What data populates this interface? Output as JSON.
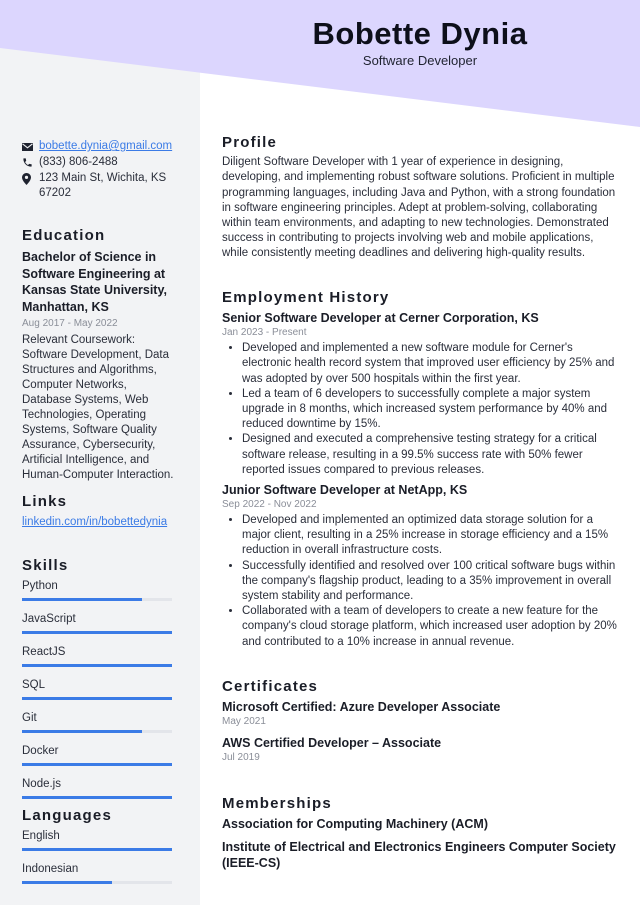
{
  "header": {
    "name": "Bobette Dynia",
    "title": "Software Developer"
  },
  "colors": {
    "header_bg": "#dcd6fe",
    "sidebar_bg": "#f2f3f5",
    "accent": "#3b7be6"
  },
  "contact": {
    "email": "bobette.dynia@gmail.com",
    "phone": "(833) 806-2488",
    "address": "123 Main St, Wichita, KS 67202",
    "icons": [
      "envelope-icon",
      "phone-icon",
      "map-pin-icon"
    ]
  },
  "education": {
    "heading": "Education",
    "degree": "Bachelor of Science in Software Engineering at Kansas State University, Manhattan, KS",
    "dates": "Aug 2017 - May 2022",
    "description": "Relevant Coursework: Software Development, Data Structures and Algorithms, Computer Networks, Database Systems, Web Technologies, Operating Systems, Software Quality Assurance, Cybersecurity, Artificial Intelligence, and Human-Computer Interaction."
  },
  "links": {
    "heading": "Links",
    "items": [
      {
        "label": "linkedin.com/in/bobettedynia"
      }
    ]
  },
  "skills": {
    "heading": "Skills",
    "items": [
      {
        "name": "Python",
        "level": 0.8
      },
      {
        "name": "JavaScript",
        "level": 1.0
      },
      {
        "name": "ReactJS",
        "level": 1.0
      },
      {
        "name": "SQL",
        "level": 1.0
      },
      {
        "name": "Git",
        "level": 0.8
      },
      {
        "name": "Docker",
        "level": 1.0
      },
      {
        "name": "Node.js",
        "level": 1.0
      }
    ]
  },
  "languages": {
    "heading": "Languages",
    "items": [
      {
        "name": "English",
        "level": 1.0
      },
      {
        "name": "Indonesian",
        "level": 0.6
      }
    ]
  },
  "profile": {
    "heading": "Profile",
    "text": "Diligent Software Developer with 1 year of experience in designing, developing, and implementing robust software solutions. Proficient in multiple programming languages, including Java and Python, with a strong foundation in software engineering principles. Adept at problem-solving, collaborating within team environments, and adapting to new technologies. Demonstrated success in contributing to projects involving web and mobile applications, while consistently meeting deadlines and delivering high-quality results."
  },
  "employment": {
    "heading": "Employment History",
    "jobs": [
      {
        "title": "Senior Software Developer at Cerner Corporation, KS",
        "dates": "Jan 2023 - Present",
        "bullets": [
          "Developed and implemented a new software module for Cerner's electronic health record system that improved user efficiency by 25% and was adopted by over 500 hospitals within the first year.",
          "Led a team of 6 developers to successfully complete a major system upgrade in 8 months, which increased system performance by 40% and reduced downtime by 15%.",
          "Designed and executed a comprehensive testing strategy for a critical software release, resulting in a 99.5% success rate with 50% fewer reported issues compared to previous releases."
        ]
      },
      {
        "title": "Junior Software Developer at NetApp, KS",
        "dates": "Sep 2022 - Nov 2022",
        "bullets": [
          "Developed and implemented an optimized data storage solution for a major client, resulting in a 25% increase in storage efficiency and a 15% reduction in overall infrastructure costs.",
          "Successfully identified and resolved over 100 critical software bugs within the company's flagship product, leading to a 35% improvement in overall system stability and performance.",
          "Collaborated with a team of developers to create a new feature for the company's cloud storage platform, which increased user adoption by 20% and contributed to a 10% increase in annual revenue."
        ]
      }
    ]
  },
  "certificates": {
    "heading": "Certificates",
    "items": [
      {
        "name": "Microsoft Certified: Azure Developer Associate",
        "date": "May 2021"
      },
      {
        "name": "AWS Certified Developer – Associate",
        "date": "Jul 2019"
      }
    ]
  },
  "memberships": {
    "heading": "Memberships",
    "items": [
      "Association for Computing Machinery (ACM)",
      "Institute of Electrical and Electronics Engineers Computer Society (IEEE-CS)"
    ]
  }
}
